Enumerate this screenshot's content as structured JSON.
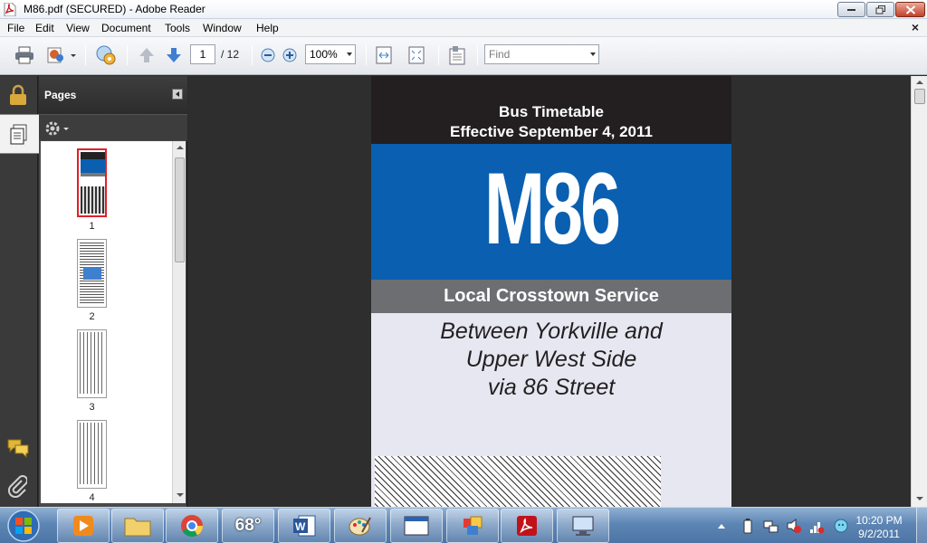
{
  "window": {
    "title": "M86.pdf (SECURED) - Adobe Reader"
  },
  "menu": [
    "File",
    "Edit",
    "View",
    "Document",
    "Tools",
    "Window",
    "Help"
  ],
  "toolbar": {
    "current_page": "1",
    "total_pages": "/ 12",
    "zoom": "100%",
    "find_placeholder": "Find"
  },
  "pages_panel": {
    "title": "Pages",
    "thumbnails": [
      "1",
      "2",
      "3",
      "4"
    ]
  },
  "document": {
    "header_line1": "Bus Timetable",
    "header_line2": "Effective September 4, 2011",
    "route": "M86",
    "service": "Local Crosstown Service",
    "between_line1": "Between Yorkville and",
    "between_line2": "Upper West Side",
    "between_line3": "via 86 Street"
  },
  "taskbar": {
    "weather": "68°",
    "time": "10:20 PM",
    "date": "9/2/2011"
  },
  "colors": {
    "route_blue": "#0a5fb0",
    "header_black": "#231f20",
    "service_gray": "#6d6e71",
    "page_bg": "#e6e7f1"
  }
}
